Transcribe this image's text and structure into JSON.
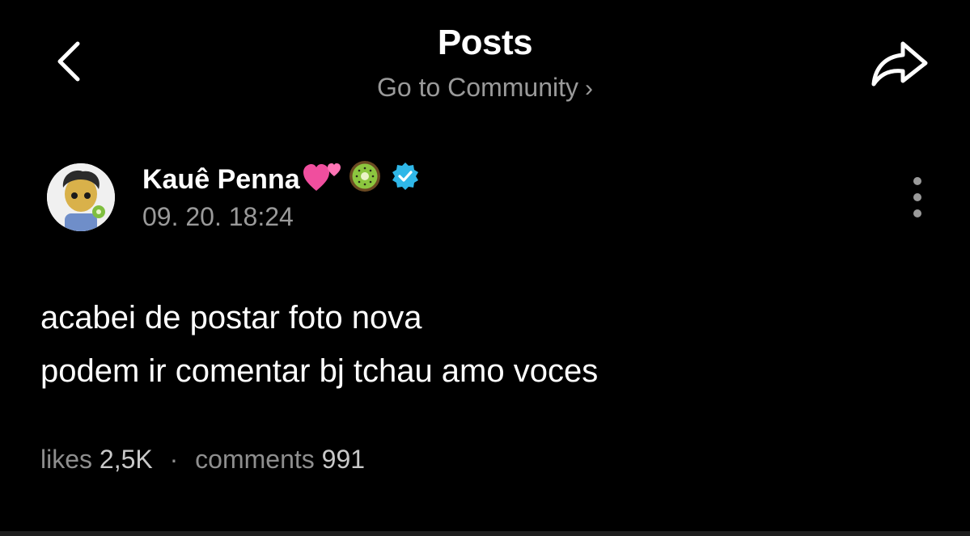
{
  "header": {
    "title": "Posts",
    "community_link": "Go to Community"
  },
  "post": {
    "author": "Kauê Penna",
    "author_emojis": [
      "two-hearts",
      "kiwi"
    ],
    "verified": true,
    "timestamp": "09. 20. 18:24",
    "body_lines": [
      "acabei de postar foto nova",
      "podem ir comentar bj tchau amo voces"
    ],
    "stats": {
      "likes_label": "likes",
      "likes_value": "2,5K",
      "comments_label": "comments",
      "comments_value": "991"
    }
  },
  "icons": {
    "back": "chevron-left-icon",
    "share": "share-arrow-icon",
    "more": "more-vertical-icon",
    "community_chevron": "chevron-right-icon",
    "verified": "verified-badge-icon"
  },
  "colors": {
    "background": "#000000",
    "text_primary": "#ffffff",
    "text_secondary": "#9a9a9a",
    "verified_badge": "#2fb7e8"
  }
}
